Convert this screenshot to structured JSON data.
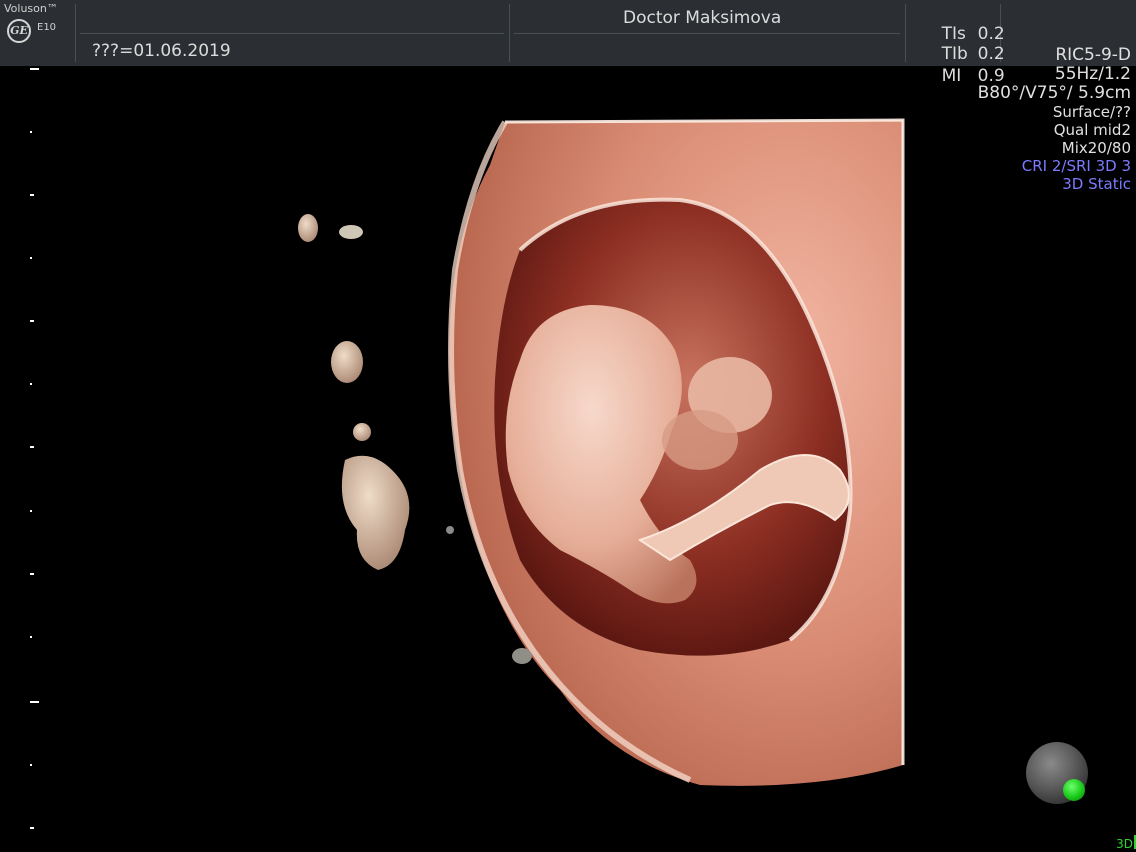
{
  "header": {
    "brand": "Voluson™",
    "logo_text": "GE",
    "model": "E10",
    "date_text": "???=01.06.2019",
    "operator": "Doctor Maksimova",
    "safety": [
      {
        "label": "TIs",
        "value": "0.2"
      },
      {
        "label": "TIb",
        "value": "0.2"
      },
      {
        "label": "MI",
        "value": "0.9"
      }
    ]
  },
  "parameters": {
    "probe": "RIC5-9-D",
    "frequency": "55Hz/1.2",
    "angles": "B80°/V75°/ 5.9cm",
    "render_mode": "Surface/??",
    "quality": "Qual mid2",
    "mix": "Mix20/80",
    "filter": "CRI 2/SRI 3D 3",
    "mode": "3D Static"
  },
  "footer": {
    "mode_indicator": "3D"
  },
  "colors": {
    "background": "#000000",
    "topbar": "#2b2f33",
    "accent_blue": "#7b7bff",
    "orientation_green": "#19c919",
    "tissue": "#e8a490"
  },
  "icons": {
    "orientation": "orientation-ball-icon",
    "logo": "ge-logo-icon"
  }
}
